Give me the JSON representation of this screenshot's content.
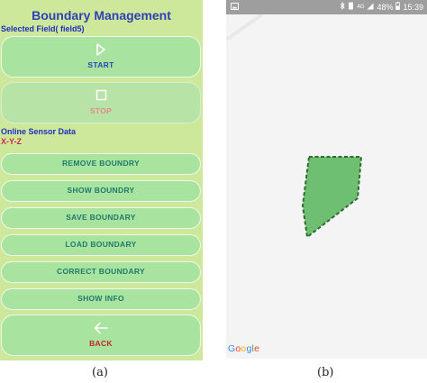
{
  "panel_a": {
    "title": "Boundary Management",
    "selected_field": "Selected Field( field5)",
    "start_button": {
      "label": "START",
      "icon": "play-icon"
    },
    "stop_button": {
      "label": "STOP",
      "icon": "stop-icon"
    },
    "sensor": {
      "title": "Online Sensor Data",
      "value": "X-Y-Z"
    },
    "actions": [
      {
        "label": "REMOVE BOUNDRY"
      },
      {
        "label": "SHOW BOUNDRY"
      },
      {
        "label": "SAVE BOUNDARY"
      },
      {
        "label": "LOAD BOUNDARY"
      },
      {
        "label": "CORRECT BOUNDARY"
      },
      {
        "label": "SHOW INFO"
      }
    ],
    "back_button": {
      "label": "BACK",
      "icon": "arrow-left-icon"
    },
    "colors": {
      "background": "#cde89a",
      "button": "#a8e3a0",
      "title": "#2f3fb5",
      "action_text": "#1f7a69",
      "back_text": "#c8232c"
    }
  },
  "panel_b": {
    "status_bar": {
      "app_icon": "image-icon",
      "bluetooth_icon": "bluetooth-icon",
      "vibrate_icon": "vibrate-icon",
      "network": "4G",
      "signal_icon": "signal-icon",
      "battery": "48%",
      "battery_icon": "battery-icon",
      "time": "15:39"
    },
    "map": {
      "logo": {
        "G": "G",
        "o1": "o",
        "o2": "o",
        "g": "g",
        "l": "l",
        "e": "e"
      },
      "boundary_fill": "#6fbf73",
      "boundary_stroke": "#2e6b2e"
    }
  },
  "captions": {
    "a": "(a)",
    "b": "(b)"
  }
}
